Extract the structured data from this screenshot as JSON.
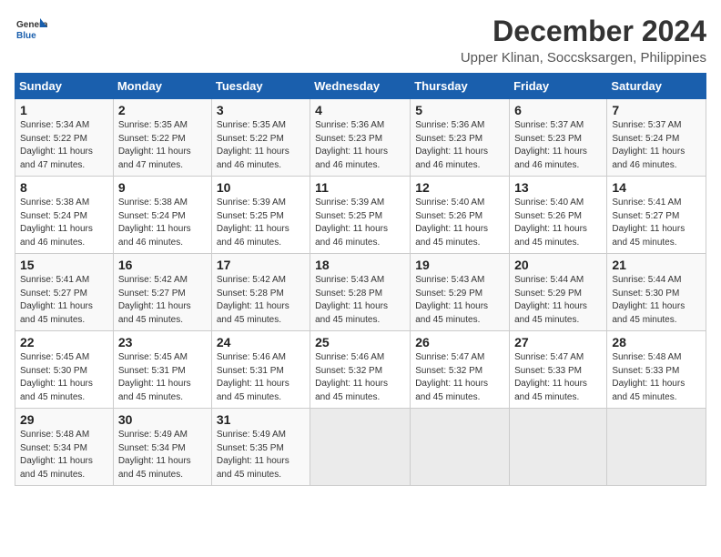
{
  "logo": {
    "general": "General",
    "blue": "Blue"
  },
  "title": "December 2024",
  "subtitle": "Upper Klinan, Soccsksargen, Philippines",
  "weekdays": [
    "Sunday",
    "Monday",
    "Tuesday",
    "Wednesday",
    "Thursday",
    "Friday",
    "Saturday"
  ],
  "weeks": [
    [
      {
        "day": "1",
        "sunrise": "Sunrise: 5:34 AM",
        "sunset": "Sunset: 5:22 PM",
        "daylight": "Daylight: 11 hours and 47 minutes."
      },
      {
        "day": "2",
        "sunrise": "Sunrise: 5:35 AM",
        "sunset": "Sunset: 5:22 PM",
        "daylight": "Daylight: 11 hours and 47 minutes."
      },
      {
        "day": "3",
        "sunrise": "Sunrise: 5:35 AM",
        "sunset": "Sunset: 5:22 PM",
        "daylight": "Daylight: 11 hours and 46 minutes."
      },
      {
        "day": "4",
        "sunrise": "Sunrise: 5:36 AM",
        "sunset": "Sunset: 5:23 PM",
        "daylight": "Daylight: 11 hours and 46 minutes."
      },
      {
        "day": "5",
        "sunrise": "Sunrise: 5:36 AM",
        "sunset": "Sunset: 5:23 PM",
        "daylight": "Daylight: 11 hours and 46 minutes."
      },
      {
        "day": "6",
        "sunrise": "Sunrise: 5:37 AM",
        "sunset": "Sunset: 5:23 PM",
        "daylight": "Daylight: 11 hours and 46 minutes."
      },
      {
        "day": "7",
        "sunrise": "Sunrise: 5:37 AM",
        "sunset": "Sunset: 5:24 PM",
        "daylight": "Daylight: 11 hours and 46 minutes."
      }
    ],
    [
      {
        "day": "8",
        "sunrise": "Sunrise: 5:38 AM",
        "sunset": "Sunset: 5:24 PM",
        "daylight": "Daylight: 11 hours and 46 minutes."
      },
      {
        "day": "9",
        "sunrise": "Sunrise: 5:38 AM",
        "sunset": "Sunset: 5:24 PM",
        "daylight": "Daylight: 11 hours and 46 minutes."
      },
      {
        "day": "10",
        "sunrise": "Sunrise: 5:39 AM",
        "sunset": "Sunset: 5:25 PM",
        "daylight": "Daylight: 11 hours and 46 minutes."
      },
      {
        "day": "11",
        "sunrise": "Sunrise: 5:39 AM",
        "sunset": "Sunset: 5:25 PM",
        "daylight": "Daylight: 11 hours and 46 minutes."
      },
      {
        "day": "12",
        "sunrise": "Sunrise: 5:40 AM",
        "sunset": "Sunset: 5:26 PM",
        "daylight": "Daylight: 11 hours and 45 minutes."
      },
      {
        "day": "13",
        "sunrise": "Sunrise: 5:40 AM",
        "sunset": "Sunset: 5:26 PM",
        "daylight": "Daylight: 11 hours and 45 minutes."
      },
      {
        "day": "14",
        "sunrise": "Sunrise: 5:41 AM",
        "sunset": "Sunset: 5:27 PM",
        "daylight": "Daylight: 11 hours and 45 minutes."
      }
    ],
    [
      {
        "day": "15",
        "sunrise": "Sunrise: 5:41 AM",
        "sunset": "Sunset: 5:27 PM",
        "daylight": "Daylight: 11 hours and 45 minutes."
      },
      {
        "day": "16",
        "sunrise": "Sunrise: 5:42 AM",
        "sunset": "Sunset: 5:27 PM",
        "daylight": "Daylight: 11 hours and 45 minutes."
      },
      {
        "day": "17",
        "sunrise": "Sunrise: 5:42 AM",
        "sunset": "Sunset: 5:28 PM",
        "daylight": "Daylight: 11 hours and 45 minutes."
      },
      {
        "day": "18",
        "sunrise": "Sunrise: 5:43 AM",
        "sunset": "Sunset: 5:28 PM",
        "daylight": "Daylight: 11 hours and 45 minutes."
      },
      {
        "day": "19",
        "sunrise": "Sunrise: 5:43 AM",
        "sunset": "Sunset: 5:29 PM",
        "daylight": "Daylight: 11 hours and 45 minutes."
      },
      {
        "day": "20",
        "sunrise": "Sunrise: 5:44 AM",
        "sunset": "Sunset: 5:29 PM",
        "daylight": "Daylight: 11 hours and 45 minutes."
      },
      {
        "day": "21",
        "sunrise": "Sunrise: 5:44 AM",
        "sunset": "Sunset: 5:30 PM",
        "daylight": "Daylight: 11 hours and 45 minutes."
      }
    ],
    [
      {
        "day": "22",
        "sunrise": "Sunrise: 5:45 AM",
        "sunset": "Sunset: 5:30 PM",
        "daylight": "Daylight: 11 hours and 45 minutes."
      },
      {
        "day": "23",
        "sunrise": "Sunrise: 5:45 AM",
        "sunset": "Sunset: 5:31 PM",
        "daylight": "Daylight: 11 hours and 45 minutes."
      },
      {
        "day": "24",
        "sunrise": "Sunrise: 5:46 AM",
        "sunset": "Sunset: 5:31 PM",
        "daylight": "Daylight: 11 hours and 45 minutes."
      },
      {
        "day": "25",
        "sunrise": "Sunrise: 5:46 AM",
        "sunset": "Sunset: 5:32 PM",
        "daylight": "Daylight: 11 hours and 45 minutes."
      },
      {
        "day": "26",
        "sunrise": "Sunrise: 5:47 AM",
        "sunset": "Sunset: 5:32 PM",
        "daylight": "Daylight: 11 hours and 45 minutes."
      },
      {
        "day": "27",
        "sunrise": "Sunrise: 5:47 AM",
        "sunset": "Sunset: 5:33 PM",
        "daylight": "Daylight: 11 hours and 45 minutes."
      },
      {
        "day": "28",
        "sunrise": "Sunrise: 5:48 AM",
        "sunset": "Sunset: 5:33 PM",
        "daylight": "Daylight: 11 hours and 45 minutes."
      }
    ],
    [
      {
        "day": "29",
        "sunrise": "Sunrise: 5:48 AM",
        "sunset": "Sunset: 5:34 PM",
        "daylight": "Daylight: 11 hours and 45 minutes."
      },
      {
        "day": "30",
        "sunrise": "Sunrise: 5:49 AM",
        "sunset": "Sunset: 5:34 PM",
        "daylight": "Daylight: 11 hours and 45 minutes."
      },
      {
        "day": "31",
        "sunrise": "Sunrise: 5:49 AM",
        "sunset": "Sunset: 5:35 PM",
        "daylight": "Daylight: 11 hours and 45 minutes."
      },
      null,
      null,
      null,
      null
    ]
  ]
}
